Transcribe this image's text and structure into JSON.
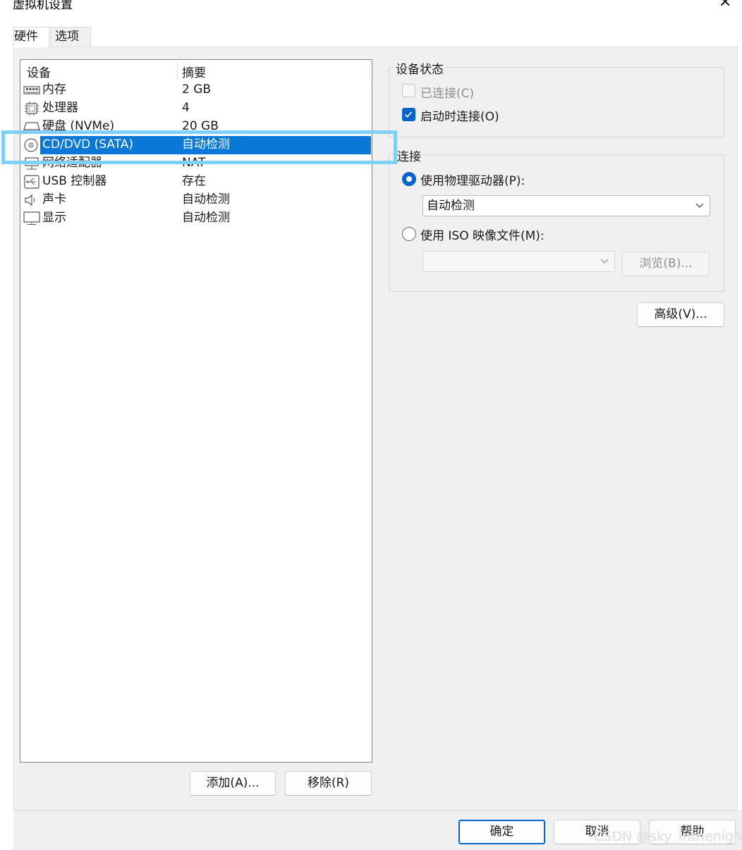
{
  "window": {
    "title": "虚拟机设置"
  },
  "tabs": [
    {
      "label": "硬件",
      "active": true
    },
    {
      "label": "选项",
      "active": false
    }
  ],
  "device_list": {
    "columns": [
      "设备",
      "摘要"
    ],
    "rows": [
      {
        "icon": "memory-icon",
        "name": "内存",
        "summary": "2 GB"
      },
      {
        "icon": "processor-icon",
        "name": "处理器",
        "summary": "4"
      },
      {
        "icon": "hard-disk-icon",
        "name": "硬盘 (NVMe)",
        "summary": "20 GB"
      },
      {
        "icon": "cd-dvd-icon",
        "name": "CD/DVD (SATA)",
        "summary": "自动检测",
        "selected": true
      },
      {
        "icon": "network-adapter-icon",
        "name": "网络适配器",
        "summary": "NAT"
      },
      {
        "icon": "usb-icon",
        "name": "USB 控制器",
        "summary": "存在"
      },
      {
        "icon": "sound-icon",
        "name": "声卡",
        "summary": "自动检测"
      },
      {
        "icon": "display-icon",
        "name": "显示",
        "summary": "自动检测"
      }
    ],
    "add_label": "添加(A)...",
    "remove_label": "移除(R)"
  },
  "device_status": {
    "legend": "设备状态",
    "connected_label": "已连接(C)",
    "connected_checked": false,
    "connect_on_start_label": "启动时连接(O)",
    "connect_on_start_checked": true
  },
  "connection": {
    "legend": "连接",
    "physical_label": "使用物理驱动器(P):",
    "physical_selected": true,
    "physical_value": "自动检测",
    "iso_label": "使用 ISO 映像文件(M):",
    "iso_selected": false,
    "iso_value": "",
    "browse_label": "浏览(B)..."
  },
  "advanced_label": "高级(V)...",
  "footer": {
    "ok_label": "确定",
    "cancel_label": "取消",
    "help_label": "帮助"
  },
  "watermark": "CSDN @sky_inthenight",
  "colors": {
    "selection": "#0a78d7",
    "accent": "#0a63c9",
    "highlight_box": "#7fd0f6"
  }
}
